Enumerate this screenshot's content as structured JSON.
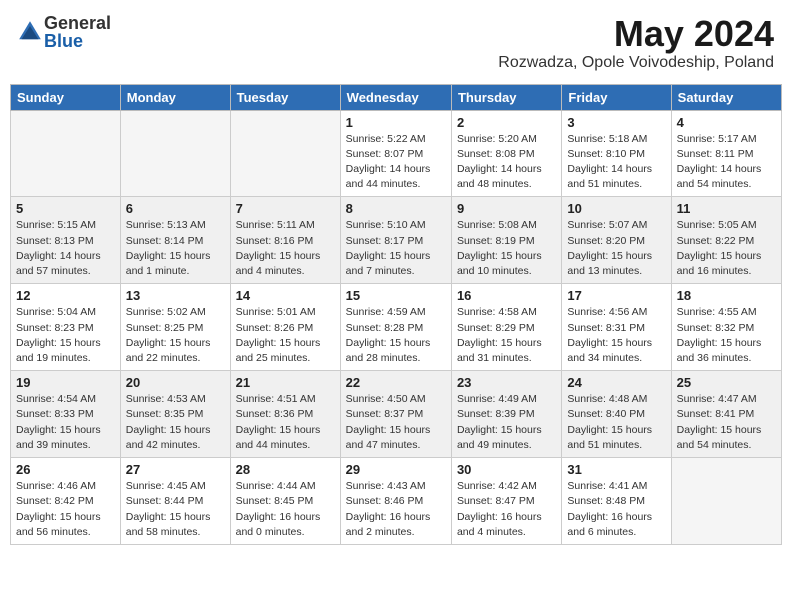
{
  "logo": {
    "general": "General",
    "blue": "Blue"
  },
  "title": "May 2024",
  "subtitle": "Rozwadza, Opole Voivodeship, Poland",
  "headers": [
    "Sunday",
    "Monday",
    "Tuesday",
    "Wednesday",
    "Thursday",
    "Friday",
    "Saturday"
  ],
  "weeks": [
    [
      {
        "day": "",
        "info": ""
      },
      {
        "day": "",
        "info": ""
      },
      {
        "day": "",
        "info": ""
      },
      {
        "day": "1",
        "info": "Sunrise: 5:22 AM\nSunset: 8:07 PM\nDaylight: 14 hours\nand 44 minutes."
      },
      {
        "day": "2",
        "info": "Sunrise: 5:20 AM\nSunset: 8:08 PM\nDaylight: 14 hours\nand 48 minutes."
      },
      {
        "day": "3",
        "info": "Sunrise: 5:18 AM\nSunset: 8:10 PM\nDaylight: 14 hours\nand 51 minutes."
      },
      {
        "day": "4",
        "info": "Sunrise: 5:17 AM\nSunset: 8:11 PM\nDaylight: 14 hours\nand 54 minutes."
      }
    ],
    [
      {
        "day": "5",
        "info": "Sunrise: 5:15 AM\nSunset: 8:13 PM\nDaylight: 14 hours\nand 57 minutes."
      },
      {
        "day": "6",
        "info": "Sunrise: 5:13 AM\nSunset: 8:14 PM\nDaylight: 15 hours\nand 1 minute."
      },
      {
        "day": "7",
        "info": "Sunrise: 5:11 AM\nSunset: 8:16 PM\nDaylight: 15 hours\nand 4 minutes."
      },
      {
        "day": "8",
        "info": "Sunrise: 5:10 AM\nSunset: 8:17 PM\nDaylight: 15 hours\nand 7 minutes."
      },
      {
        "day": "9",
        "info": "Sunrise: 5:08 AM\nSunset: 8:19 PM\nDaylight: 15 hours\nand 10 minutes."
      },
      {
        "day": "10",
        "info": "Sunrise: 5:07 AM\nSunset: 8:20 PM\nDaylight: 15 hours\nand 13 minutes."
      },
      {
        "day": "11",
        "info": "Sunrise: 5:05 AM\nSunset: 8:22 PM\nDaylight: 15 hours\nand 16 minutes."
      }
    ],
    [
      {
        "day": "12",
        "info": "Sunrise: 5:04 AM\nSunset: 8:23 PM\nDaylight: 15 hours\nand 19 minutes."
      },
      {
        "day": "13",
        "info": "Sunrise: 5:02 AM\nSunset: 8:25 PM\nDaylight: 15 hours\nand 22 minutes."
      },
      {
        "day": "14",
        "info": "Sunrise: 5:01 AM\nSunset: 8:26 PM\nDaylight: 15 hours\nand 25 minutes."
      },
      {
        "day": "15",
        "info": "Sunrise: 4:59 AM\nSunset: 8:28 PM\nDaylight: 15 hours\nand 28 minutes."
      },
      {
        "day": "16",
        "info": "Sunrise: 4:58 AM\nSunset: 8:29 PM\nDaylight: 15 hours\nand 31 minutes."
      },
      {
        "day": "17",
        "info": "Sunrise: 4:56 AM\nSunset: 8:31 PM\nDaylight: 15 hours\nand 34 minutes."
      },
      {
        "day": "18",
        "info": "Sunrise: 4:55 AM\nSunset: 8:32 PM\nDaylight: 15 hours\nand 36 minutes."
      }
    ],
    [
      {
        "day": "19",
        "info": "Sunrise: 4:54 AM\nSunset: 8:33 PM\nDaylight: 15 hours\nand 39 minutes."
      },
      {
        "day": "20",
        "info": "Sunrise: 4:53 AM\nSunset: 8:35 PM\nDaylight: 15 hours\nand 42 minutes."
      },
      {
        "day": "21",
        "info": "Sunrise: 4:51 AM\nSunset: 8:36 PM\nDaylight: 15 hours\nand 44 minutes."
      },
      {
        "day": "22",
        "info": "Sunrise: 4:50 AM\nSunset: 8:37 PM\nDaylight: 15 hours\nand 47 minutes."
      },
      {
        "day": "23",
        "info": "Sunrise: 4:49 AM\nSunset: 8:39 PM\nDaylight: 15 hours\nand 49 minutes."
      },
      {
        "day": "24",
        "info": "Sunrise: 4:48 AM\nSunset: 8:40 PM\nDaylight: 15 hours\nand 51 minutes."
      },
      {
        "day": "25",
        "info": "Sunrise: 4:47 AM\nSunset: 8:41 PM\nDaylight: 15 hours\nand 54 minutes."
      }
    ],
    [
      {
        "day": "26",
        "info": "Sunrise: 4:46 AM\nSunset: 8:42 PM\nDaylight: 15 hours\nand 56 minutes."
      },
      {
        "day": "27",
        "info": "Sunrise: 4:45 AM\nSunset: 8:44 PM\nDaylight: 15 hours\nand 58 minutes."
      },
      {
        "day": "28",
        "info": "Sunrise: 4:44 AM\nSunset: 8:45 PM\nDaylight: 16 hours\nand 0 minutes."
      },
      {
        "day": "29",
        "info": "Sunrise: 4:43 AM\nSunset: 8:46 PM\nDaylight: 16 hours\nand 2 minutes."
      },
      {
        "day": "30",
        "info": "Sunrise: 4:42 AM\nSunset: 8:47 PM\nDaylight: 16 hours\nand 4 minutes."
      },
      {
        "day": "31",
        "info": "Sunrise: 4:41 AM\nSunset: 8:48 PM\nDaylight: 16 hours\nand 6 minutes."
      },
      {
        "day": "",
        "info": ""
      }
    ]
  ]
}
